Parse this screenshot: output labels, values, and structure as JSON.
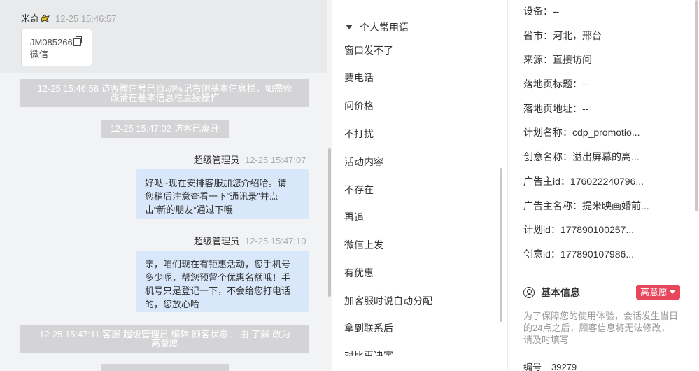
{
  "chat": {
    "customer": {
      "name": "米奇",
      "time": "12-25 15:46:57"
    },
    "card": {
      "id": "JM085266",
      "type": "微信"
    },
    "system1": {
      "line1": "12-25 15:46:58 访客微信号已自动标记右侧基本信息栏，如需修",
      "line2": "改请在基本信息栏直接操作"
    },
    "system2": "12-25 15:47:02 访客已离开",
    "msg1": {
      "sender": "超级管理员",
      "time": "12-25 15:47:07",
      "lines": [
        "好哒~现在安排客服加您介绍哈。请",
        "您稍后注意查看一下“通讯录”并点",
        "击“新的朋友”通过下哦"
      ]
    },
    "msg2": {
      "sender": "超级管理员",
      "time": "12-25 15:47:10",
      "lines": [
        "亲，咱们现在有钜惠活动，您手机号",
        "多少呢，帮您预留个优惠名额哦！手",
        "机号只是登记一下，不会给您打电话",
        "的，您放心哈"
      ]
    },
    "system3": {
      "line1": "12-25 15:47:11 客服 超级管理员 编辑 顾客状态： 由 了解 改为",
      "line2": "高意愿"
    }
  },
  "phrases": {
    "group_title": "个人常用语",
    "items": [
      "窗口发不了",
      "要电话",
      "问价格",
      "不打扰",
      "活动内容",
      "不存在",
      "再追",
      "微信上发",
      "有优惠",
      "加客服时说自动分配",
      "拿到联系后",
      "对比再决定"
    ]
  },
  "info": {
    "rows": [
      {
        "label": "设备：",
        "value": "--"
      },
      {
        "label": "省市：",
        "value": "河北，邢台"
      },
      {
        "label": "来源：",
        "value": "直接访问"
      },
      {
        "label": "落地页标题：",
        "value": "--"
      },
      {
        "label": "落地页地址：",
        "value": "--"
      },
      {
        "label": "计划名称：",
        "value": "cdp_promotio..."
      },
      {
        "label": "创意名称：",
        "value": "溢出屏幕的高..."
      },
      {
        "label": "广告主id：",
        "value": "176022240796..."
      },
      {
        "label": "广告主名称：",
        "value": "提米映画婚前..."
      },
      {
        "label": "计划id：",
        "value": "177890100257..."
      },
      {
        "label": "创意id：",
        "value": "177890107986..."
      }
    ],
    "basic_title": "基本信息",
    "intent_label": "高意愿",
    "notice": "为了保障您的使用体验，会话发生当日的24点之后，顾客信息将无法修改，请及时填写",
    "id_label": "编号",
    "id_value": "39279"
  },
  "colors": {
    "accent_red": "#e8465a",
    "bubble": "#d9e7fb",
    "system_msg": "#d4d4d6"
  }
}
